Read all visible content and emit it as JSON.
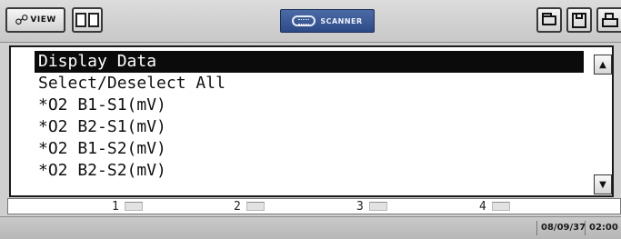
{
  "toolbar": {
    "view_label": "VIEW",
    "view_icon": "binoculars-icon",
    "split_icon": "split-screen-icon",
    "scanner_label": "SCANNER",
    "scanner_icon": "connector-icon",
    "right_icons": [
      "folder-icon",
      "save-icon",
      "print-icon"
    ]
  },
  "list": {
    "items": [
      "Display Data",
      "Select/Deselect All",
      "*O2 B1-S1(mV)",
      "*O2 B2-S1(mV)",
      "*O2 B1-S2(mV)",
      "*O2 B2-S2(mV)"
    ],
    "selected_index": 0
  },
  "channels": [
    "1",
    "2",
    "3",
    "4"
  ],
  "status": {
    "date": "08/09/37",
    "time": "02:00"
  },
  "colors": {
    "selection_bg": "#0b0b0b",
    "scanner_badge": "#2c4a86"
  }
}
